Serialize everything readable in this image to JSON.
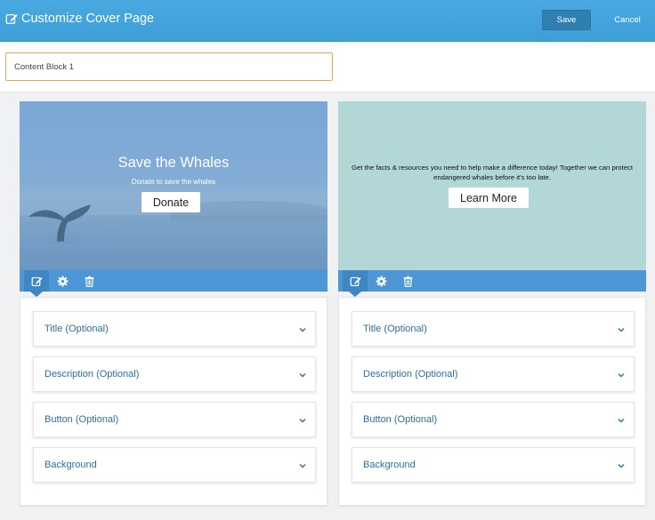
{
  "header": {
    "title": "Customize Cover Page",
    "save_label": "Save",
    "cancel_label": "Cancel",
    "icons": {
      "title": "edit-icon"
    }
  },
  "block_name": {
    "value": "Content Block 1"
  },
  "blocks": [
    {
      "preview": {
        "title": "Save the Whales",
        "subtitle": "Donate to save the whales",
        "button_label": "Donate",
        "background": "whale-tail-ocean-image"
      },
      "toolbar": [
        "edit-icon",
        "gear-icon",
        "trash-icon"
      ],
      "sections": [
        {
          "label": "Title (Optional)"
        },
        {
          "label": "Description (Optional)"
        },
        {
          "label": "Button (Optional)"
        },
        {
          "label": "Background"
        }
      ]
    },
    {
      "preview": {
        "description": "Get the facts & resources you need to help make a difference today! Together we can protect endangered whales before it's too late.",
        "button_label": "Learn More",
        "background_color": "#b3d7d7"
      },
      "toolbar": [
        "edit-icon",
        "gear-icon",
        "trash-icon"
      ],
      "sections": [
        {
          "label": "Title (Optional)"
        },
        {
          "label": "Description (Optional)"
        },
        {
          "label": "Button (Optional)"
        },
        {
          "label": "Background"
        }
      ]
    }
  ],
  "colors": {
    "header": "#4aa9e0",
    "save_button": "#2f7fb1",
    "toolbar": "#4d97d6",
    "input_border": "#f0a54a",
    "section_label": "#2c6fa0"
  }
}
